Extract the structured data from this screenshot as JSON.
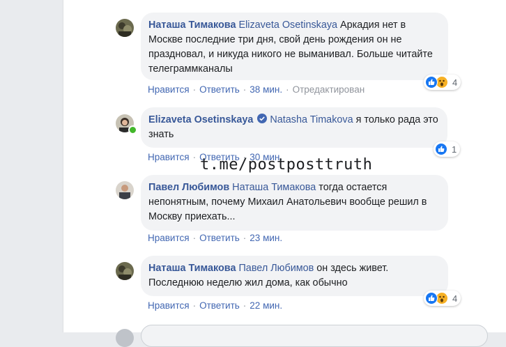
{
  "comments": [
    {
      "author": "Наташа Тимакова",
      "mention": "Elizaveta Osetinskaya",
      "text": "Аркадия нет в Москве последние три дня, свой день рождения он не праздновал, и никуда никого не выманивал. Больше читайте телеграммканалы",
      "like": "Нравится",
      "reply": "Ответить",
      "time": "38 мин.",
      "edited": "Отредактирован",
      "reaction_count": "4"
    },
    {
      "author": "Elizaveta Osetinskaya",
      "mention": "Natasha Timakova",
      "text": "я только рада это знать",
      "like": "Нравится",
      "reply": "Ответить",
      "time": "30 мин.",
      "reaction_count": "1"
    },
    {
      "author": "Павел Любимов",
      "mention": "Наташа Тимакова",
      "text": "тогда остается непонятным, почему Михаил Анатольевич вообще решил в Москву приехать...",
      "like": "Нравится",
      "reply": "Ответить",
      "time": "23 мин."
    },
    {
      "author": "Наташа Тимакова",
      "mention": "Павел Любимов",
      "text": "он здесь живет. Последнюю неделю жил дома, как обычно",
      "like": "Нравится",
      "reply": "Ответить",
      "time": "22 мин.",
      "reaction_count": "4"
    }
  ],
  "separator": "·",
  "watermark": "t.me/postposttruth",
  "icons": {
    "like": "thumbs-up-icon",
    "wow": "wow-face-icon",
    "verified": "verified-badge-icon"
  },
  "colors": {
    "link": "#385898",
    "action": "#4267b2",
    "bubble": "#f2f3f5",
    "like": "#1877f2",
    "online": "#42b72a"
  }
}
